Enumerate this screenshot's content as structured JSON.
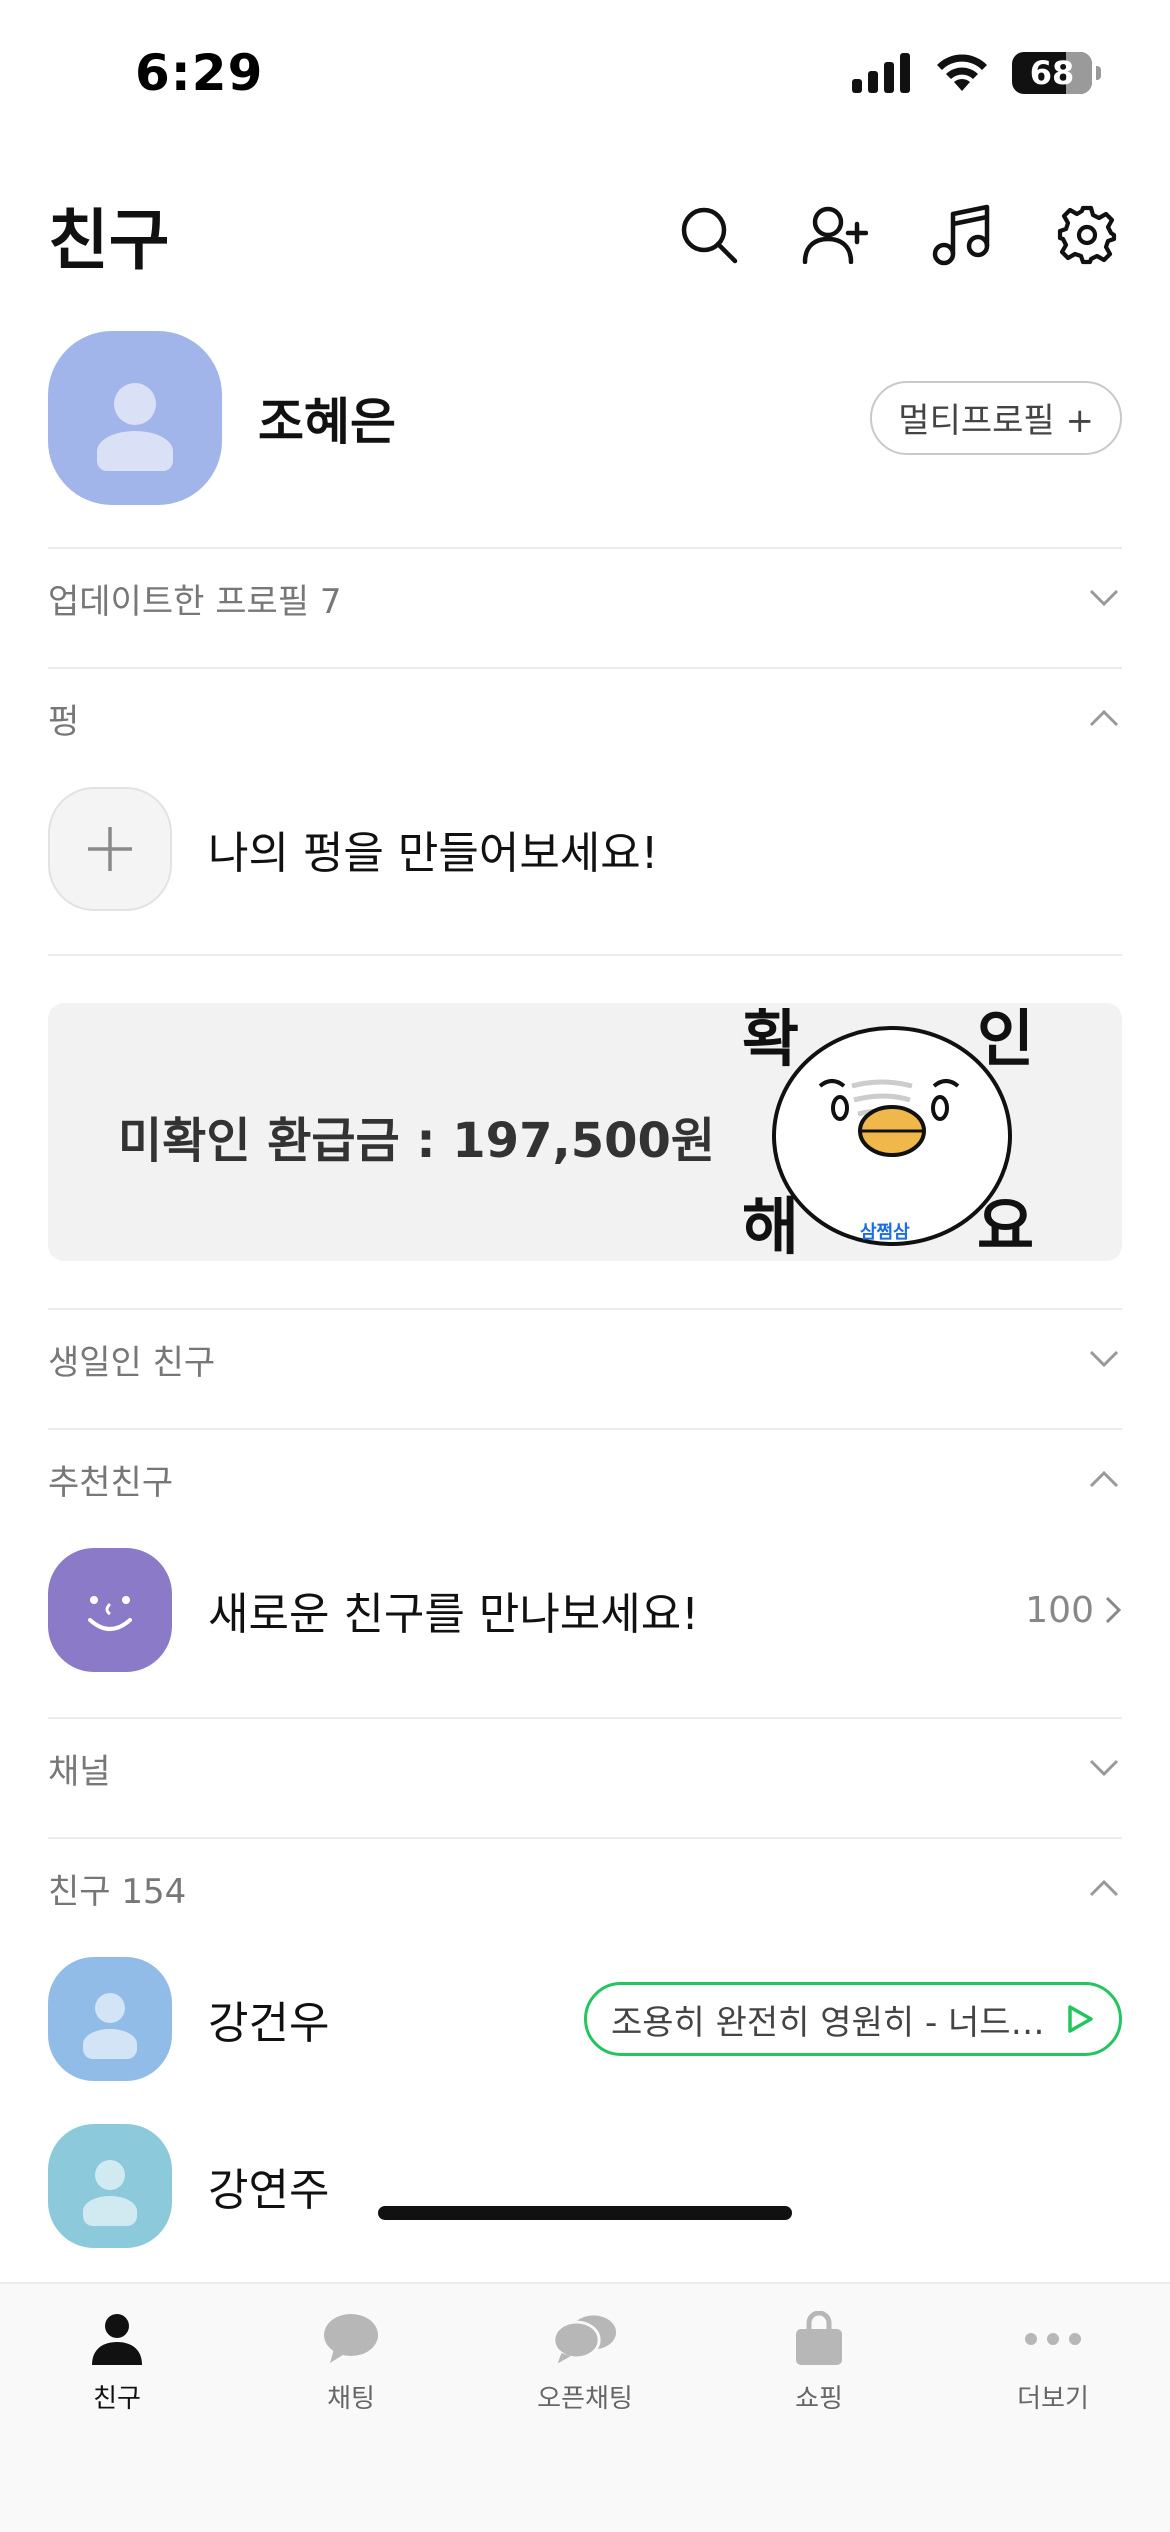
{
  "status_bar": {
    "time": "6:29",
    "battery_level": "68",
    "battery_fraction": 0.68
  },
  "header": {
    "title": "친구"
  },
  "my_profile": {
    "name": "조혜은",
    "multi_profile_label": "멀티프로필 +"
  },
  "sections": {
    "updated_profiles": "업데이트한 프로필 7",
    "pung": "펑",
    "birthday": "생일인 친구",
    "recommended": "추천친구",
    "channel": "채널",
    "friends": "친구 154"
  },
  "pung": {
    "create_label": "나의 펑을 만들어보세요!"
  },
  "banner": {
    "text": "미확인 환급금 : 197,500원",
    "art_chars": [
      "확",
      "인",
      "해",
      "요"
    ],
    "art_brand": "삼쩜삼"
  },
  "recommended": {
    "label": "새로운 친구를 만나보세요!",
    "count": "100"
  },
  "friends": [
    {
      "name": "강건우",
      "music": "조용히 완전히 영원히 - 너드…",
      "color": "#92bce8"
    },
    {
      "name": "강연주",
      "color": "#8ccadb"
    }
  ],
  "tab_bar": {
    "tabs": [
      {
        "label": "친구",
        "icon": "person-icon"
      },
      {
        "label": "채팅",
        "icon": "chat-bubble-icon"
      },
      {
        "label": "오픈채팅",
        "icon": "open-chat-icon"
      },
      {
        "label": "쇼핑",
        "icon": "shopping-bag-icon"
      },
      {
        "label": "더보기",
        "icon": "more-icon"
      }
    ]
  },
  "colors": {
    "accent_green": "#22c55e",
    "my_avatar": "#a2b5ea",
    "recommend_avatar": "#8b7ac8"
  }
}
